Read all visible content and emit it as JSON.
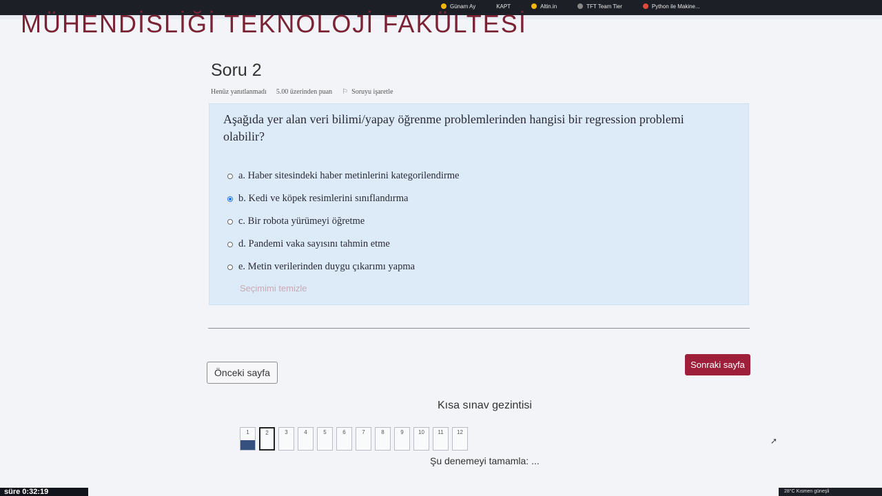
{
  "browser": {
    "bookmarks": [
      {
        "icon": "star-icon",
        "label": "Günam Ay"
      },
      {
        "icon": "bookmark-icon",
        "label": "KAPT"
      },
      {
        "icon": "gold-icon",
        "label": "Altin.in"
      },
      {
        "icon": "grid-icon",
        "label": "TFT Team Tier"
      },
      {
        "icon": "book-icon",
        "label": "Python ile Makine..."
      }
    ]
  },
  "header": {
    "faculty_title": "MÜHENDİSLİĞİ TEKNOLOJİ FAKÜLTESİ"
  },
  "question": {
    "number_label": "Soru 2",
    "status": "Henüz yanıtlanmadı",
    "points": "5.00 üzerinden puan",
    "flag_label": "Soruyu işaretle",
    "text": "Aşağıda yer alan veri bilimi/yapay öğrenme problemlerinden hangisi bir regression problemi olabilir?",
    "answers": [
      {
        "label": "a. Haber sitesindeki haber metinlerini kategorilendirme",
        "selected": false
      },
      {
        "label": "b. Kedi ve köpek resimlerini sınıflandırma",
        "selected": true
      },
      {
        "label": "c. Bir robota yürümeyi öğretme",
        "selected": false
      },
      {
        "label": "d. Pandemi vaka sayısını tahmin etme",
        "selected": false
      },
      {
        "label": "e. Metin verilerinden duygu çıkarımı yapma",
        "selected": false
      }
    ],
    "clear_choice": "Seçimimi temizle"
  },
  "navigation": {
    "prev_label": "Önceki sayfa",
    "next_label": "Sonraki sayfa",
    "quiz_nav_title": "Kısa sınav gezintisi",
    "pages": [
      "1",
      "2",
      "3",
      "4",
      "5",
      "6",
      "7",
      "8",
      "9",
      "10",
      "11",
      "12"
    ],
    "answered_pages": [
      "1"
    ],
    "current_page": "2",
    "finish_label": "Şu denemeyi tamamla: ..."
  },
  "system": {
    "timer": "süre 0:32:19",
    "weather": "28°C  Kısmen güneşli"
  },
  "colors": {
    "accent": "#9e1f3a",
    "question_bg": "#dcebf7",
    "nav_answered": "#35507e"
  }
}
